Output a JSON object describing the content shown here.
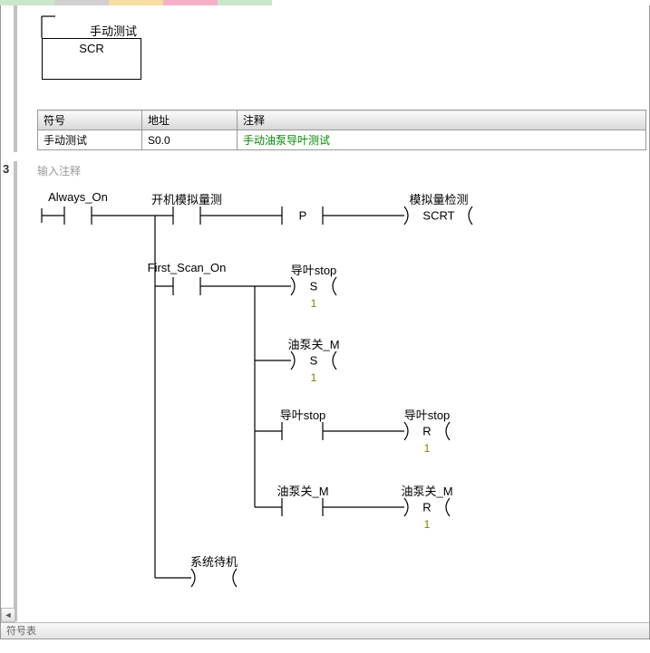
{
  "network1": {
    "scr_top_label": "手动测试",
    "scr_box_label": "SCR",
    "table": {
      "headers": {
        "symbol": "符号",
        "address": "地址",
        "comment": "注释"
      },
      "row": {
        "symbol": "手动测试",
        "address": "S0.0",
        "comment": "手动油泵导叶测试"
      }
    }
  },
  "network3": {
    "number": "3",
    "comment_placeholder": "输入注释",
    "contacts": {
      "always_on": "Always_On",
      "kaiji": "开机模拟量测",
      "first_scan": "First_Scan_On",
      "xitong": "系统待机"
    },
    "mids": {
      "p": "P",
      "daoye_stop_c1": "导叶stop",
      "youbeng_c1": "油泵关_M",
      "daoye_stop_c2": "导叶stop",
      "youbeng_c2": "油泵关_M"
    },
    "coils": {
      "moni_head": "模拟量检测",
      "moni": "SCRT",
      "s1": "S",
      "s2": "S",
      "daoye_r_head": "导叶stop",
      "r1": "R",
      "youbeng_r_head": "油泵关_M",
      "r2": "R",
      "one": "1"
    }
  },
  "bottom_label": "符号表",
  "chart_data": {
    "type": "table",
    "title": "Symbol Table",
    "columns": [
      "符号",
      "地址",
      "注释"
    ],
    "rows": [
      [
        "手动测试",
        "S0.0",
        "手动油泵导叶测试"
      ]
    ]
  }
}
